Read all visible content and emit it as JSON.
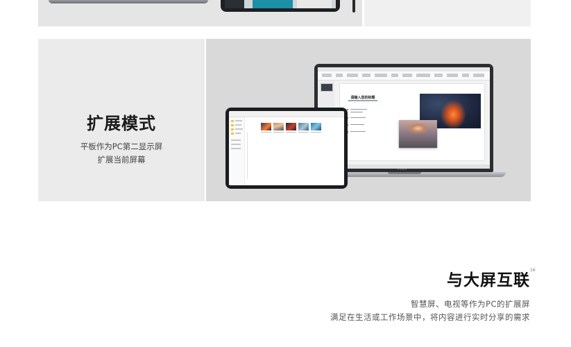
{
  "extend_mode": {
    "title": "扩展模式",
    "desc_line1": "平板作为PC第二显示屏",
    "desc_line2": "扩展当前屏幕",
    "slide_title": "请输入您的标题"
  },
  "big_screen": {
    "title": "与大屏互联",
    "footnote": "16",
    "line1": "智慧屏、电视等作为PC的扩展屏",
    "line2": "满足在生活或工作场景中，将内容进行实时分享的需求"
  },
  "laptop_brand": "HONOR",
  "colors": {
    "panel_light": "#ebebeb",
    "panel_dark": "#d9d9d9",
    "device_dark": "#1b1c1f",
    "text_dark": "#1a1a1a"
  }
}
